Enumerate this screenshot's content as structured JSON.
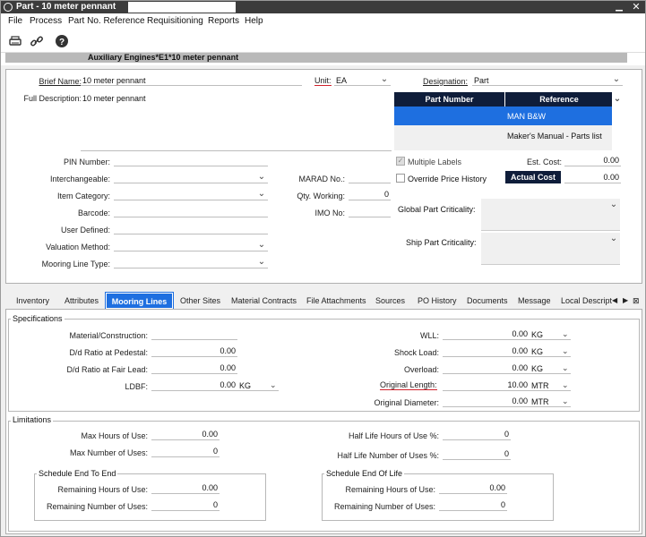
{
  "window": {
    "title": "Part - 10 meter pennant"
  },
  "menu": [
    "File",
    "Process",
    "Part No. Reference",
    "Requisitioning",
    "Reports",
    "Help"
  ],
  "path": "Auxiliary Engines*E1*10 meter pennant",
  "form": {
    "brief_name_label": "Brief Name:",
    "brief_name": "10 meter pennant",
    "unit_label": "Unit:",
    "unit": "EA",
    "full_desc_label": "Full Description:",
    "full_desc": "10 meter pennant",
    "designation_label": "Designation:",
    "designation": "Part",
    "pin_label": "PIN Number:",
    "interchangeable_label": "Interchangeable:",
    "item_category_label": "Item Category:",
    "barcode_label": "Barcode:",
    "user_defined_label": "User Defined:",
    "valuation_label": "Valuation Method:",
    "mooring_type_label": "Mooring Line Type:",
    "marad_label": "MARAD No.:",
    "qty_working_label": "Qty. Working:",
    "qty_working": "0",
    "imo_label": "IMO No:",
    "multiple_labels": "Multiple Labels",
    "override_price": "Override Price History",
    "est_cost_label": "Est. Cost:",
    "est_cost": "0.00",
    "actual_cost_label": "Actual Cost",
    "actual_cost": "0.00",
    "global_crit_label": "Global Part Criticality:",
    "ship_crit_label": "Ship Part Criticality:"
  },
  "ref_table": {
    "headers": [
      "Part Number",
      "Reference"
    ],
    "rows": [
      [
        "",
        "MAN B&W"
      ],
      [
        "",
        "Maker's Manual - Parts list"
      ]
    ]
  },
  "tabs": [
    "Inventory",
    "Attributes",
    "Mooring Lines",
    "Other Sites",
    "Material Contracts",
    "File Attachments",
    "Sources",
    "PO History",
    "Documents",
    "Message",
    "Local Descript"
  ],
  "active_tab": "Mooring Lines",
  "specifications": {
    "title": "Specifications",
    "material_label": "Material/Construction:",
    "dd_pedestal_label": "D/d Ratio at Pedestal:",
    "dd_pedestal": "0.00",
    "dd_fairlead_label": "D/d Ratio at Fair Lead:",
    "dd_fairlead": "0.00",
    "ldbf_label": "LDBF:",
    "ldbf": "0.00",
    "ldbf_unit": "KG",
    "wll_label": "WLL:",
    "wll": "0.00",
    "wll_unit": "KG",
    "shock_label": "Shock Load:",
    "shock": "0.00",
    "shock_unit": "KG",
    "overload_label": "Overload:",
    "overload": "0.00",
    "overload_unit": "KG",
    "orig_len_label": "Original Length:",
    "orig_len": "10.00",
    "orig_len_unit": "MTR",
    "orig_dia_label": "Original Diameter:",
    "orig_dia": "0.00",
    "orig_dia_unit": "MTR"
  },
  "limitations": {
    "title": "Limitations",
    "max_hours_label": "Max Hours of Use:",
    "max_hours": "0.00",
    "max_uses_label": "Max Number of Uses:",
    "max_uses": "0",
    "half_hours_label": "Half Life Hours of Use %:",
    "half_hours": "0",
    "half_uses_label": "Half Life Number of Uses %:",
    "half_uses": "0",
    "ete_title": "Schedule End To End",
    "ete_rem_hours_label": "Remaining Hours of Use:",
    "ete_rem_hours": "0.00",
    "ete_rem_uses_label": "Remaining Number of Uses:",
    "ete_rem_uses": "0",
    "eol_title": "Schedule End Of Life",
    "eol_rem_hours_label": "Remaining Hours of Use:",
    "eol_rem_hours": "0.00",
    "eol_rem_uses_label": "Remaining Number of Uses:",
    "eol_rem_uses": "0"
  },
  "colors": {
    "accent": "#1e6fe0",
    "header_dark": "#0f1d3a",
    "title_bar": "#3c3c3c"
  }
}
